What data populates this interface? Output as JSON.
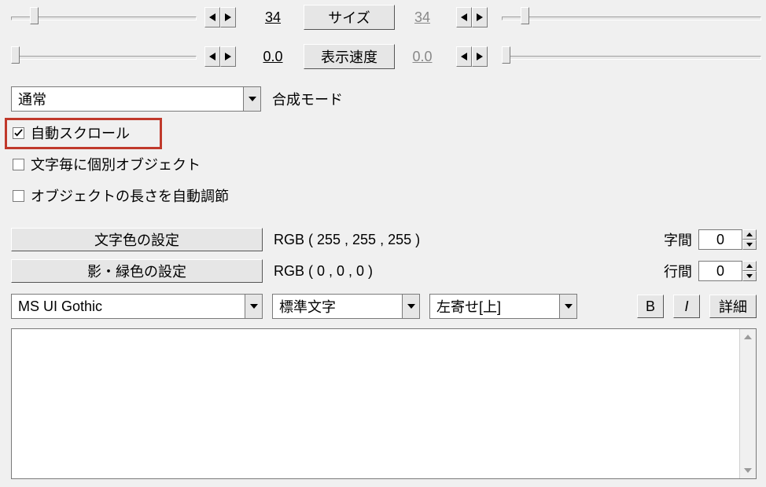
{
  "params": {
    "size": {
      "left_value": "34",
      "button": "サイズ",
      "right_value": "34"
    },
    "speed": {
      "left_value": "0.0",
      "button": "表示速度",
      "right_value": "0.0"
    }
  },
  "compose": {
    "mode_selected": "通常",
    "mode_label": "合成モード"
  },
  "checks": {
    "auto_scroll": {
      "label": "自動スクロール",
      "checked": true
    },
    "per_char": {
      "label": "文字毎に個別オブジェクト",
      "checked": false
    },
    "auto_length": {
      "label": "オブジェクトの長さを自動調節",
      "checked": false
    }
  },
  "color": {
    "text_btn": "文字色の設定",
    "text_rgb": "RGB ( 255 , 255 , 255 )",
    "shadow_btn": "影・緑色の設定",
    "shadow_rgb": "RGB ( 0 , 0 , 0 )"
  },
  "spacing": {
    "char_label": "字間",
    "char_value": "0",
    "line_label": "行間",
    "line_value": "0"
  },
  "fontrow": {
    "font": "MS UI Gothic",
    "style": "標準文字",
    "align": "左寄せ[上]",
    "bold": "B",
    "italic": "I",
    "detail": "詳細"
  },
  "textarea_value": ""
}
